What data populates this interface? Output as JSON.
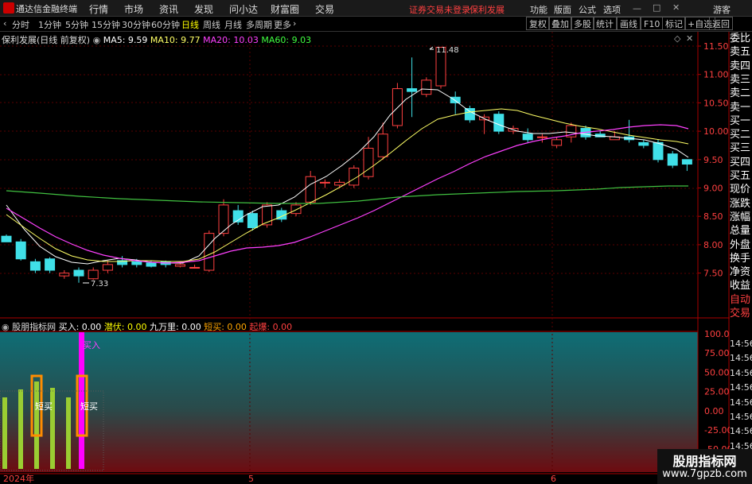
{
  "titlebar": {
    "app": "通达信金融终端",
    "menus": [
      "行情",
      "市场",
      "资讯",
      "发现",
      "问小达",
      "财富圈",
      "交易"
    ],
    "warning": "证券交易未登录",
    "stock": "保利发展",
    "right_menus": [
      "功能",
      "版面",
      "公式",
      "选项"
    ],
    "user": "游客"
  },
  "toolbar": {
    "periods": [
      "分时",
      "1分钟",
      "5分钟",
      "15分钟",
      "30分钟",
      "60分钟",
      "日线",
      "周线",
      "月线",
      "多周期",
      "更多"
    ],
    "active": "日线",
    "buttons": [
      "复权",
      "叠加",
      "多股",
      "统计",
      "画线",
      "F10",
      "标记",
      "+自选",
      "返回"
    ]
  },
  "chart_info": {
    "title": "保利发展(日线 前复权)",
    "ma5": "MA5: 9.59",
    "ma10": "MA10: 9.77",
    "ma20": "MA20: 10.03",
    "ma60": "MA60: 9.03"
  },
  "price_axis": [
    "11.50",
    "11.00",
    "10.50",
    "10.00",
    "9.50",
    "9.00",
    "8.50",
    "8.00",
    "7.50"
  ],
  "annotations": {
    "high": "11.48",
    "low": "7.33"
  },
  "indicator_info": {
    "name": "股朋指标网",
    "buy": "买入: 0.00",
    "lurk": "潜伏: 0.00",
    "jwl": "九万里: 0.00",
    "short": "短买: 0.00",
    "explode": "起爆: 0.00"
  },
  "indicator_axis": [
    "100.0",
    "75.00",
    "50.00",
    "25.00",
    "0.00",
    "-25.00",
    "-50.00",
    "-75.00"
  ],
  "indicator_labels": {
    "buy_mark": "买入",
    "short_buy": "短买"
  },
  "date_axis": [
    "2024年",
    "5",
    "6"
  ],
  "sidebar": [
    "委比",
    "卖五",
    "卖四",
    "卖三",
    "卖二",
    "卖一",
    "买一",
    "买二",
    "买三",
    "买四",
    "买五",
    "现价",
    "涨跌",
    "涨幅",
    "总量",
    "外盘",
    "换手",
    "净资",
    "收益",
    "自动",
    "交易"
  ],
  "sidebar_times": [
    "14:56",
    "14:56",
    "14:56",
    "14:56",
    "14:56",
    "14:56",
    "14:56",
    "14:56",
    "14:56"
  ],
  "watermark": {
    "line1": "股朋指标网",
    "line2": "www.7gpzb.com"
  },
  "chart_data": {
    "type": "candlestick",
    "ylim": [
      7.2,
      11.65
    ],
    "candles": [
      [
        8.15,
        8.05,
        8.18,
        8.05
      ],
      [
        8.05,
        7.75,
        8.1,
        7.72
      ],
      [
        7.7,
        7.55,
        7.75,
        7.5
      ],
      [
        7.75,
        7.55,
        7.78,
        7.5
      ],
      [
        7.45,
        7.5,
        7.55,
        7.4
      ],
      [
        7.55,
        7.45,
        7.6,
        7.33
      ],
      [
        7.4,
        7.55,
        7.6,
        7.38
      ],
      [
        7.55,
        7.65,
        7.72,
        7.5
      ],
      [
        7.72,
        7.65,
        7.8,
        7.6
      ],
      [
        7.7,
        7.65,
        7.75,
        7.6
      ],
      [
        7.68,
        7.62,
        7.72,
        7.6
      ],
      [
        7.7,
        7.65,
        7.72,
        7.6
      ],
      [
        7.62,
        7.65,
        7.7,
        7.6
      ],
      [
        7.6,
        7.6,
        7.65,
        7.58
      ],
      [
        7.55,
        8.2,
        8.25,
        7.52
      ],
      [
        8.2,
        8.7,
        8.8,
        8.15
      ],
      [
        8.6,
        8.4,
        8.7,
        8.35
      ],
      [
        8.55,
        8.3,
        8.6,
        8.25
      ],
      [
        8.35,
        8.7,
        8.75,
        8.3
      ],
      [
        8.6,
        8.45,
        8.65,
        8.4
      ],
      [
        8.55,
        8.7,
        8.75,
        8.5
      ],
      [
        8.75,
        9.2,
        9.3,
        8.7
      ],
      [
        9.1,
        9.1,
        9.15,
        9.0
      ],
      [
        9.05,
        9.1,
        9.15,
        9.0
      ],
      [
        9.05,
        9.35,
        9.4,
        9.0
      ],
      [
        9.2,
        9.7,
        9.9,
        9.15
      ],
      [
        9.55,
        9.95,
        10.15,
        9.5
      ],
      [
        10.1,
        10.75,
        10.85,
        10.05
      ],
      [
        10.75,
        10.7,
        11.3,
        10.25
      ],
      [
        10.65,
        10.9,
        10.95,
        10.6
      ],
      [
        10.8,
        11.48,
        11.48,
        10.75
      ],
      [
        10.6,
        10.5,
        10.7,
        10.3
      ],
      [
        10.4,
        10.2,
        10.45,
        10.15
      ],
      [
        10.2,
        10.25,
        10.3,
        9.95
      ],
      [
        10.3,
        10.0,
        10.35,
        9.95
      ],
      [
        10.0,
        10.05,
        10.1,
        9.95
      ],
      [
        9.95,
        9.85,
        10.05,
        9.8
      ],
      [
        9.9,
        9.9,
        9.95,
        9.8
      ],
      [
        9.75,
        9.85,
        9.9,
        9.7
      ],
      [
        9.9,
        10.1,
        10.15,
        9.8
      ],
      [
        10.05,
        9.9,
        10.1,
        9.85
      ],
      [
        9.95,
        9.9,
        10.0,
        9.9
      ],
      [
        9.85,
        9.9,
        10.0,
        9.85
      ],
      [
        9.9,
        9.85,
        10.2,
        9.8
      ],
      [
        9.8,
        9.75,
        9.85,
        9.7
      ],
      [
        9.8,
        9.5,
        9.85,
        9.45
      ],
      [
        9.6,
        9.4,
        9.65,
        9.35
      ],
      [
        9.5,
        9.42,
        9.5,
        9.3
      ]
    ]
  }
}
